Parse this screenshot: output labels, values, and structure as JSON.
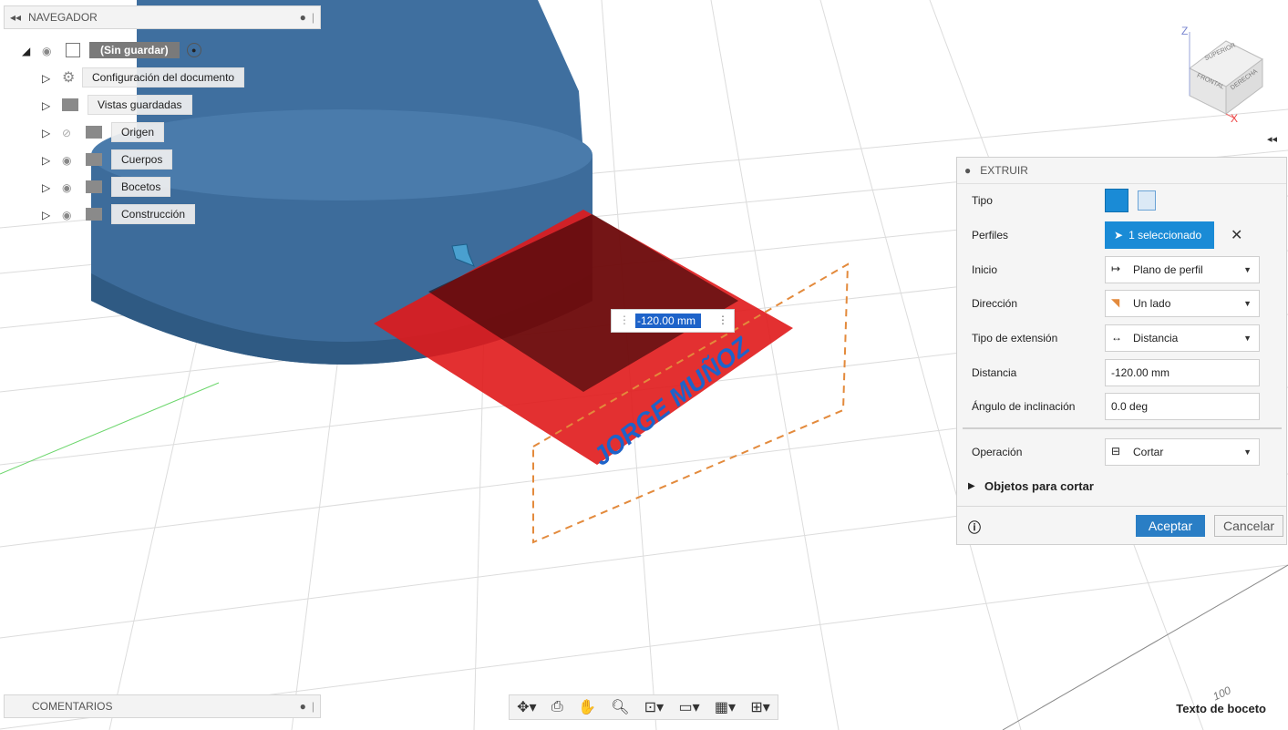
{
  "navigator": {
    "title": "NAVEGADOR",
    "root_label": "(Sin guardar)",
    "items": [
      {
        "label": "Configuración del documento",
        "icon": "gear-icon"
      },
      {
        "label": "Vistas guardadas",
        "icon": "folder-icon"
      },
      {
        "label": "Origen",
        "icon": "folder-icon"
      },
      {
        "label": "Cuerpos",
        "icon": "folder-icon"
      },
      {
        "label": "Bocetos",
        "icon": "folder-icon"
      },
      {
        "label": "Construcción",
        "icon": "folder-icon"
      }
    ]
  },
  "viewcube": {
    "faces": [
      "SUPERIOR",
      "FRONTAL",
      "DERECHA"
    ],
    "axes": [
      "Z",
      "X"
    ]
  },
  "canvas": {
    "dimension_value": "-120.00 mm",
    "sketch_text": "JORGE MUÑOZ",
    "grid_label": "100"
  },
  "extrude": {
    "title": "EXTRUIR",
    "rows": {
      "tipo": "Tipo",
      "perfiles": "Perfiles",
      "perfiles_value": "1 seleccionado",
      "inicio": "Inicio",
      "inicio_value": "Plano de perfil",
      "direccion": "Dirección",
      "direccion_value": "Un lado",
      "tipo_ext": "Tipo de extensión",
      "tipo_ext_value": "Distancia",
      "distancia": "Distancia",
      "distancia_value": "-120.00 mm",
      "angulo": "Ángulo de inclinación",
      "angulo_value": "0.0 deg",
      "operacion": "Operación",
      "operacion_value": "Cortar",
      "objetos": "Objetos para cortar"
    },
    "ok": "Aceptar",
    "cancel": "Cancelar"
  },
  "comments": {
    "title": "COMENTARIOS"
  },
  "status": "Texto de boceto",
  "colors": {
    "accent": "#1a8bd6",
    "body": "#3f6f9f",
    "cut": "#e0191b"
  }
}
